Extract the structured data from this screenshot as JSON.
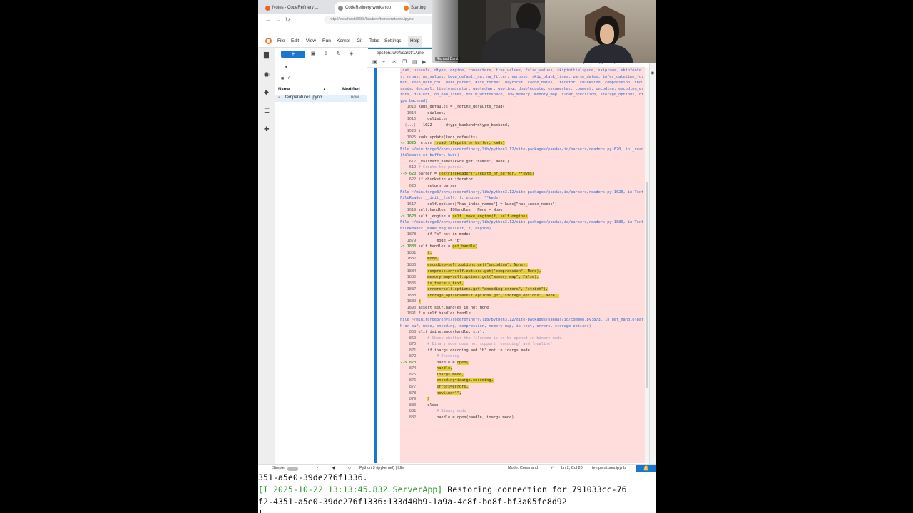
{
  "browser": {
    "tabs": [
      "Notes - CodeRefinery ...",
      "CodeRefinery workshop",
      "Starting"
    ],
    "url": "http://localhost:8888/lab/tree/temperatures.ipynb"
  },
  "jupyter": {
    "menus": [
      "File",
      "Edit",
      "View",
      "Run",
      "Kernel",
      "Git",
      "Tabs",
      "Settings",
      "Help"
    ],
    "breadcrumb": "/",
    "file_list": {
      "col_name": "Name",
      "col_modified": "Modified",
      "rows": [
        {
          "name": "temperatures.ipynb",
          "modified": "now"
        }
      ]
    },
    "doc_tab": "epsilon:/u/04/darstr1/unix",
    "toolbar_cell_type": "Code",
    "kernel_indicator": "Python 3 (ipykernel)"
  },
  "status_bar": {
    "mode_label": "Simple",
    "kernel": "Python 3 (ipykernel) | Idle",
    "mode": "Mode: Command",
    "position": "Ln 2, Col 20",
    "file": "temperatures.ipynb"
  },
  "traceback": [
    {
      "n": "",
      "t": "_cat, usecols, dtype, engine, converters, true_values, false_values, skipinitialspace, skiprows, skipfooter, nrows, na_values, keep_default_na, na_filter, verbose, skip_blank_lines, parse_dates, infer_datetime_format, keep_date_col, date_parser, date_format, dayfirst, cache_dates, iterator, chunksize, compression, thousands, decimal, lineterminator, quotechar, quoting, doublequote, escapechar, comment, encoding, encoding_errors, dialect, on_bad_lines, delim_whitespace, low_memory, memory_map, float_precision, storage_options, dtype_backend)",
      "c": "lk"
    },
    {
      "n": "1013",
      "t": "kwds_defaults = _refine_defaults_read("
    },
    {
      "n": "1014",
      "t": "    dialect,"
    },
    {
      "n": "1015",
      "t": "    delimiter,"
    },
    {
      "n": "(...)",
      "t": "  1022      dtype_backend=dtype_backend,"
    },
    {
      "n": "1023",
      "t": ")"
    },
    {
      "n": "1025",
      "t": "kwds.update(kwds_defaults)"
    },
    {
      "n": "-> 1026",
      "t": "return ",
      "h": "_read(filepath_or_buffer, kwds)"
    },
    {
      "n": "",
      "t": ""
    },
    {
      "n": "",
      "t": "File ~/miniforge3/envs/coderefinery/lib/python3.12/site-packages/pandas/io/parsers/readers.py:620, in _read(filepath_or_buffer, kwds)",
      "c": "lk"
    },
    {
      "n": "617",
      "t": "_validate_names(kwds.get(\"names\", None))"
    },
    {
      "n": "619",
      "t": "# Create the parser.",
      "c": "dim"
    },
    {
      "n": "--> 620",
      "t": "parser = ",
      "h": "TextFileReader(filepath_or_buffer, **kwds)"
    },
    {
      "n": "622",
      "t": "if chunksize or iterator:"
    },
    {
      "n": "623",
      "t": "    return parser"
    },
    {
      "n": "",
      "t": ""
    },
    {
      "n": "",
      "t": "File ~/miniforge3/envs/coderefinery/lib/python3.12/site-packages/pandas/io/parsers/readers.py:1620, in TextFileReader.__init__(self, f, engine, **kwds)",
      "c": "lk"
    },
    {
      "n": "1617",
      "t": "    self.options[\"has_index_names\"] = kwds[\"has_index_names\"]"
    },
    {
      "n": "1619",
      "t": "self.handles: IOHandles | None = None"
    },
    {
      "n": "-> 1620",
      "t": "self._engine = ",
      "h": "self._make_engine(f, self.engine)"
    },
    {
      "n": "",
      "t": ""
    },
    {
      "n": "",
      "t": "File ~/miniforge3/envs/coderefinery/lib/python3.12/site-packages/pandas/io/parsers/readers.py:1880, in TextFileReader._make_engine(self, f, engine)",
      "c": "lk"
    },
    {
      "n": "1878",
      "t": "    if \"b\" not in mode:"
    },
    {
      "n": "1879",
      "t": "        mode += \"b\""
    },
    {
      "n": "-> 1880",
      "t": "self.handles = ",
      "h": "get_handle("
    },
    {
      "n": "1881",
      "t": "    ",
      "h": "f,"
    },
    {
      "n": "1882",
      "t": "    ",
      "h": "mode,"
    },
    {
      "n": "1883",
      "t": "    ",
      "h": "encoding=self.options.get(\"encoding\", None),"
    },
    {
      "n": "1884",
      "t": "    ",
      "h": "compression=self.options.get(\"compression\", None),"
    },
    {
      "n": "1885",
      "t": "    ",
      "h": "memory_map=self.options.get(\"memory_map\", False),"
    },
    {
      "n": "1886",
      "t": "    ",
      "h": "is_text=is_text,"
    },
    {
      "n": "1887",
      "t": "    ",
      "h": "errors=self.options.get(\"encoding_errors\", \"strict\"),"
    },
    {
      "n": "1888",
      "t": "    ",
      "h": "storage_options=self.options.get(\"storage_options\", None),"
    },
    {
      "n": "1889",
      "t": "",
      "h": ")"
    },
    {
      "n": "1890",
      "t": "assert self.handles is not None"
    },
    {
      "n": "1891",
      "t": "f = self.handles.handle"
    },
    {
      "n": "",
      "t": ""
    },
    {
      "n": "",
      "t": "File ~/miniforge3/envs/coderefinery/lib/python3.12/site-packages/pandas/io/common.py:873, in get_handle(path_or_buf, mode, encoding, compression, memory_map, is_text, errors, storage_options)",
      "c": "lk"
    },
    {
      "n": "868",
      "t": "elif isinstance(handle, str):"
    },
    {
      "n": "869",
      "t": "    # Check whether the filename is to be opened in binary mode.",
      "c": "dim"
    },
    {
      "n": "870",
      "t": "    # Binary mode does not support 'encoding' and 'newline'.",
      "c": "dim"
    },
    {
      "n": "871",
      "t": "    if ioargs.encoding and \"b\" not in ioargs.mode:"
    },
    {
      "n": "872",
      "t": "        # Encoding",
      "c": "dim"
    },
    {
      "n": "--> 873",
      "t": "        handle = ",
      "h": "open("
    },
    {
      "n": "874",
      "t": "        ",
      "h": "handle,"
    },
    {
      "n": "875",
      "t": "        ",
      "h": "ioargs.mode,"
    },
    {
      "n": "876",
      "t": "        ",
      "h": "encoding=ioargs.encoding,"
    },
    {
      "n": "877",
      "t": "        ",
      "h": "errors=errors,"
    },
    {
      "n": "878",
      "t": "        ",
      "h": "newline=\"\","
    },
    {
      "n": "879",
      "t": "    ",
      "h": ")"
    },
    {
      "n": "880",
      "t": "    else:"
    },
    {
      "n": "881",
      "t": "        # Binary mode",
      "c": "dim"
    },
    {
      "n": "882",
      "t": "        handle = open(handle, ioargs.mode)"
    }
  ],
  "terminal": {
    "line1": "351-a5e0-39de276f1336.",
    "line2_prefix": "[I 2025-10-22 13:13:45.832 ServerApp]",
    "line2_rest": " Restoring connection for 791033cc-76",
    "line3": "f2-4351-a5e0-39de276f1336:133d40b9-1a9a-4c8f-bd8f-bf3a05fe8d92",
    "line4": "|"
  },
  "webcam": {
    "label": "Richard Darst"
  },
  "colors": {
    "jupyter_blue": "#1976d2",
    "error_bg": "#ffdddd",
    "highlight": "#e6cf3a",
    "terminal_green": "#2c9a2c"
  }
}
